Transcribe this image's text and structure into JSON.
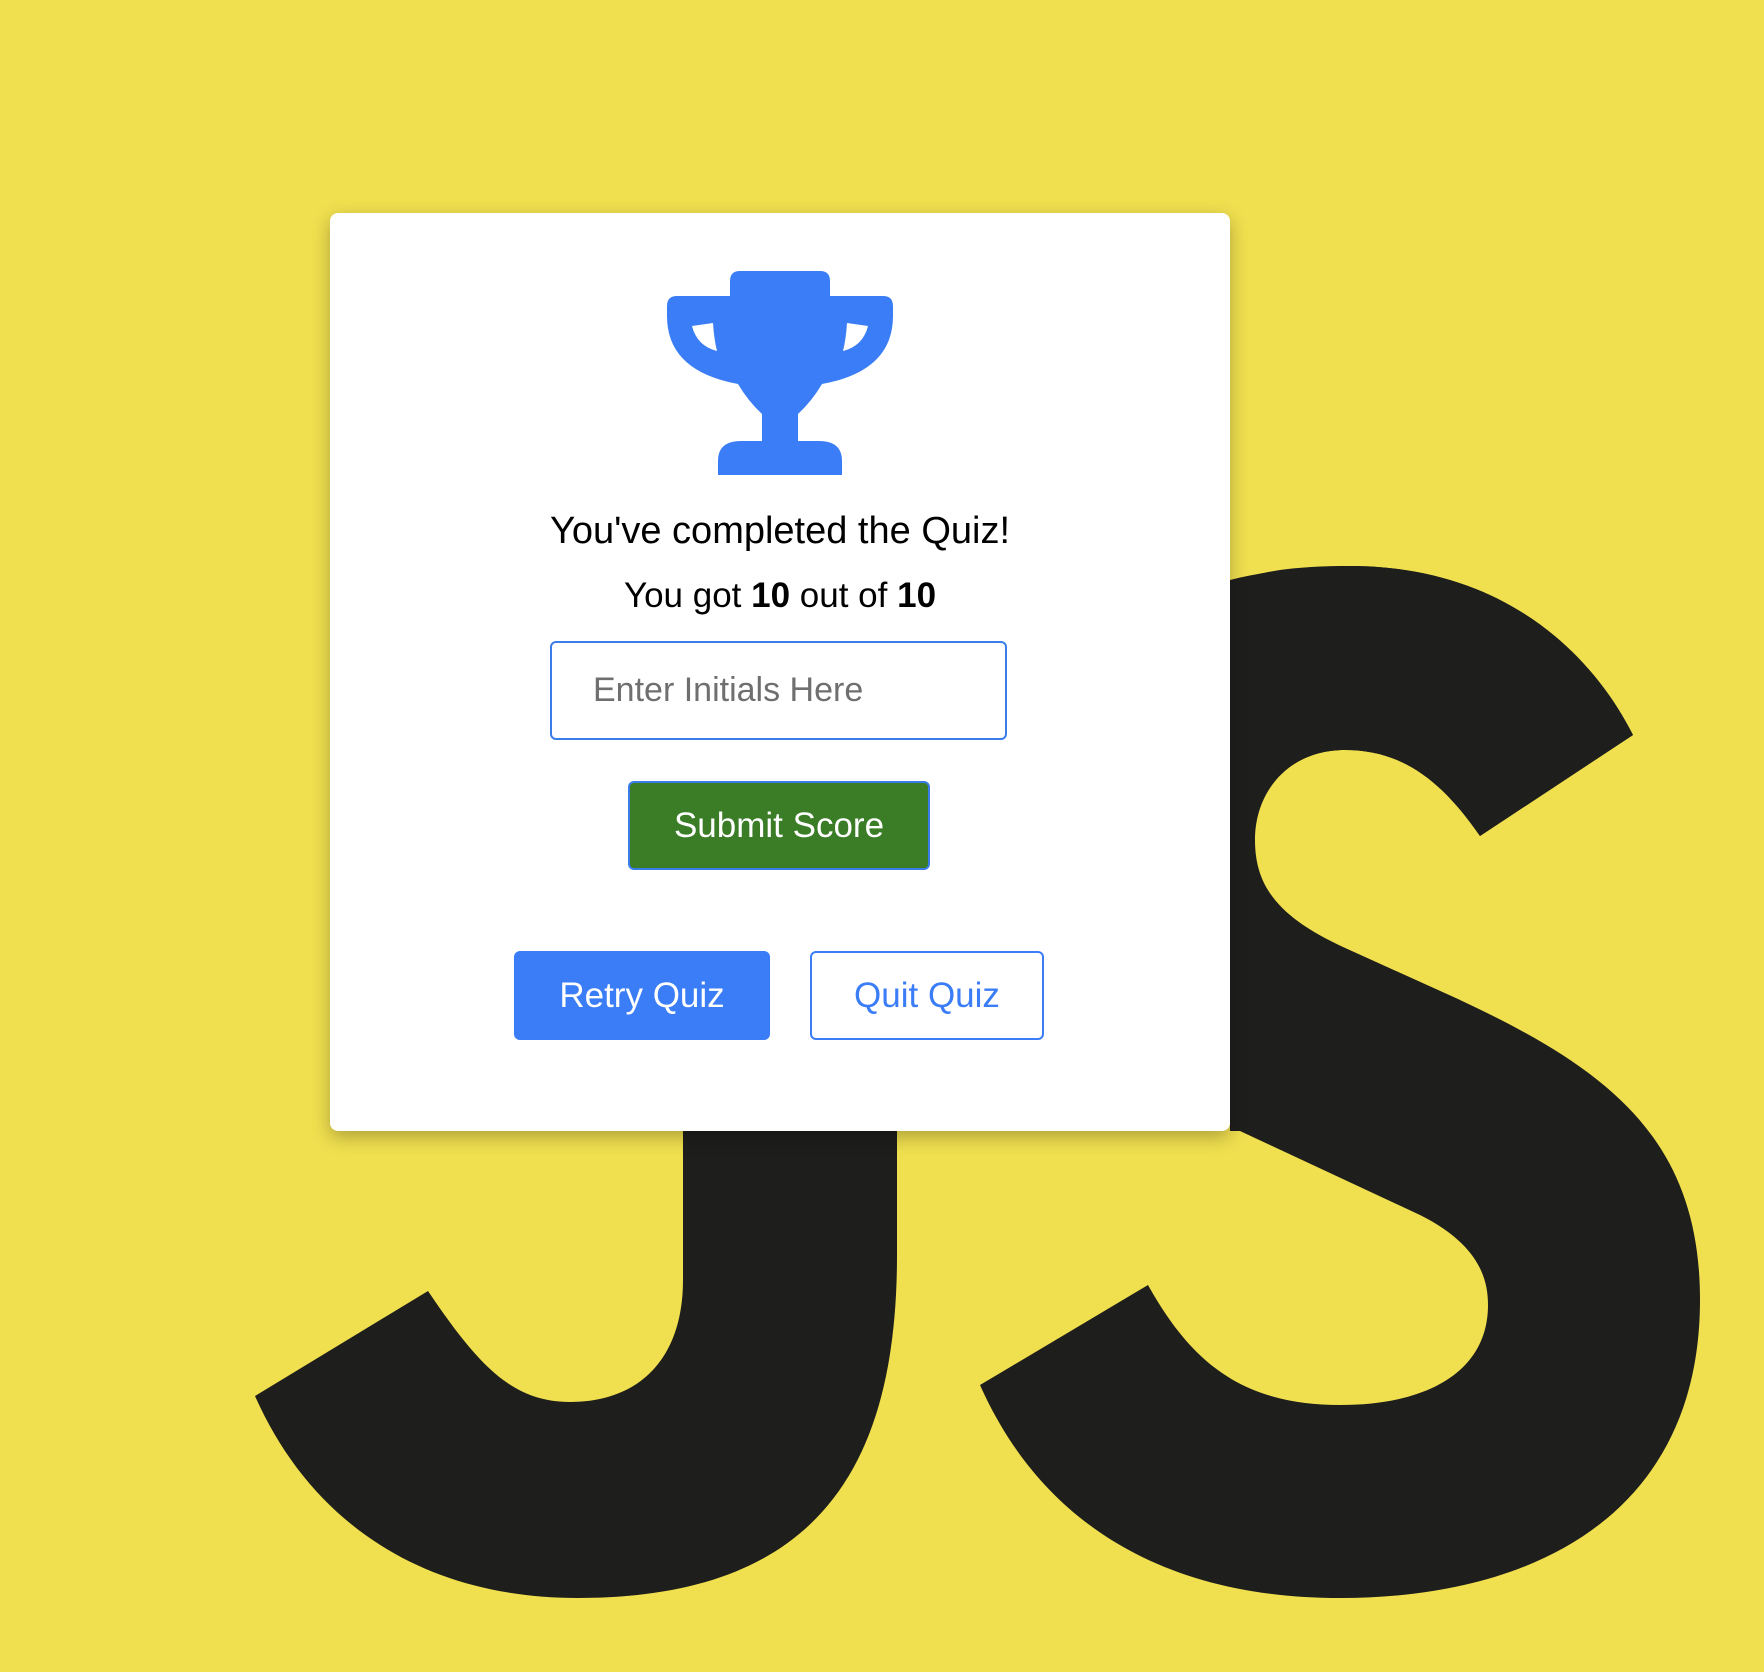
{
  "background": {
    "color": "#f0df4f",
    "logo_icon": "js-logo-icon",
    "logo_color": "#1e1e1c"
  },
  "result_card": {
    "trophy_icon": "trophy-icon",
    "trophy_color": "#3b7df6",
    "heading": "You've completed the Quiz!",
    "score": {
      "prefix": "You got",
      "correct": "10",
      "middle": "out of",
      "total": "10"
    },
    "initials_input": {
      "placeholder": "Enter Initials Here",
      "value": ""
    },
    "submit_label": "Submit Score",
    "retry_label": "Retry Quiz",
    "quit_label": "Quit Quiz"
  },
  "colors": {
    "primary": "#3b7df6",
    "submit": "#3b7d26"
  }
}
